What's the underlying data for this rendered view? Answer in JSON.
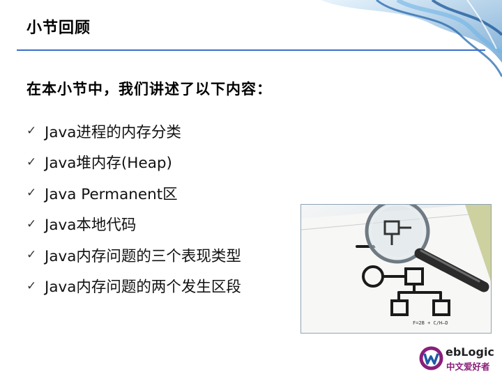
{
  "slide": {
    "title": "小节回顾",
    "intro": "在本小节中，我们讲述了以下内容：",
    "bullets": [
      "Java进程的内存分类",
      "Java堆内存(Heap)",
      "Java Permanent区",
      "Java本地代码",
      "Java内存问题的三个表现类型",
      "Java内存问题的两个发生区段"
    ],
    "bullet_icon": "check-icon",
    "image_caption": "F=2B + C/H—D",
    "logo": {
      "word": "ebLogic",
      "cn": "中文爱好者"
    }
  },
  "colors": {
    "accent_rule": "#3a6fc9",
    "logo_purple": "#8a1e7a"
  }
}
